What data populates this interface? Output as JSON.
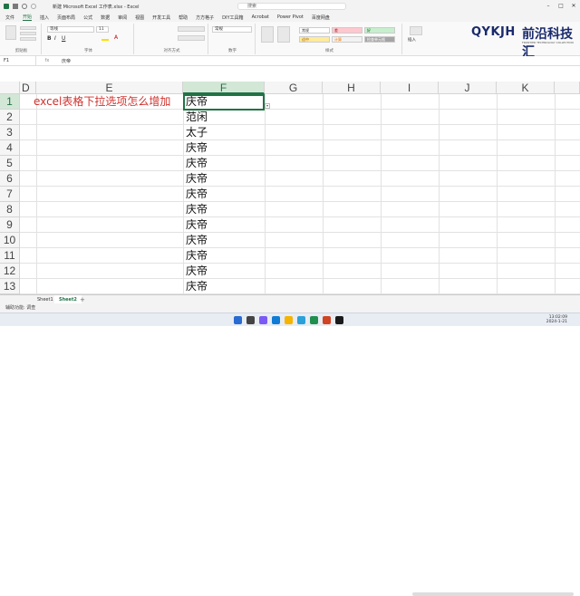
{
  "titlebar": {
    "title": "新建 Microsoft Excel 工作表.xlsx - Excel",
    "search_placeholder": "搜索"
  },
  "menu": [
    "文件",
    "开始",
    "插入",
    "页面布局",
    "公式",
    "数据",
    "审阅",
    "视图",
    "开发工具",
    "帮助",
    "方方格子",
    "DIY工具箱",
    "Acrobat",
    "Power Pivot",
    "百度网盘"
  ],
  "ribbon": {
    "groups": [
      "剪贴板",
      "字体",
      "对齐方式",
      "数字",
      "样式",
      "单元格"
    ],
    "font_name": "等线",
    "font_size": "11",
    "number_format": "常规",
    "styles": [
      "常规",
      "差",
      "好",
      "适中",
      "计算",
      "检查单元格"
    ],
    "insert_label": "插入"
  },
  "logo": {
    "brand": "QYKJH",
    "name": "前沿科技汇",
    "tagline": "FRONTIER TECHNOLOGY COLLECTION"
  },
  "formula_bar": {
    "name_box": "F1",
    "fx": "fx",
    "value": "庆帝"
  },
  "grid": {
    "columns": [
      "D",
      "E",
      "F",
      "G",
      "H",
      "I",
      "J",
      "K"
    ],
    "selected_column": "F",
    "rows": [
      "1",
      "2",
      "3",
      "4",
      "5",
      "6",
      "7",
      "8",
      "9",
      "10",
      "11",
      "12",
      "13"
    ],
    "title_cell": "excel表格下拉选项怎么增加",
    "f_values": [
      "庆帝",
      "范闲",
      "太子",
      "庆帝",
      "庆帝",
      "庆帝",
      "庆帝",
      "庆帝",
      "庆帝",
      "庆帝",
      "庆帝",
      "庆帝",
      "庆帝"
    ]
  },
  "sheets": [
    "Sheet1",
    "Sheet2"
  ],
  "status": "辅助功能: 调查",
  "clock": {
    "time": "13:02:09",
    "date": "2024-1-21"
  },
  "colors": {
    "accent": "#217346",
    "title_text": "#d0312d"
  }
}
